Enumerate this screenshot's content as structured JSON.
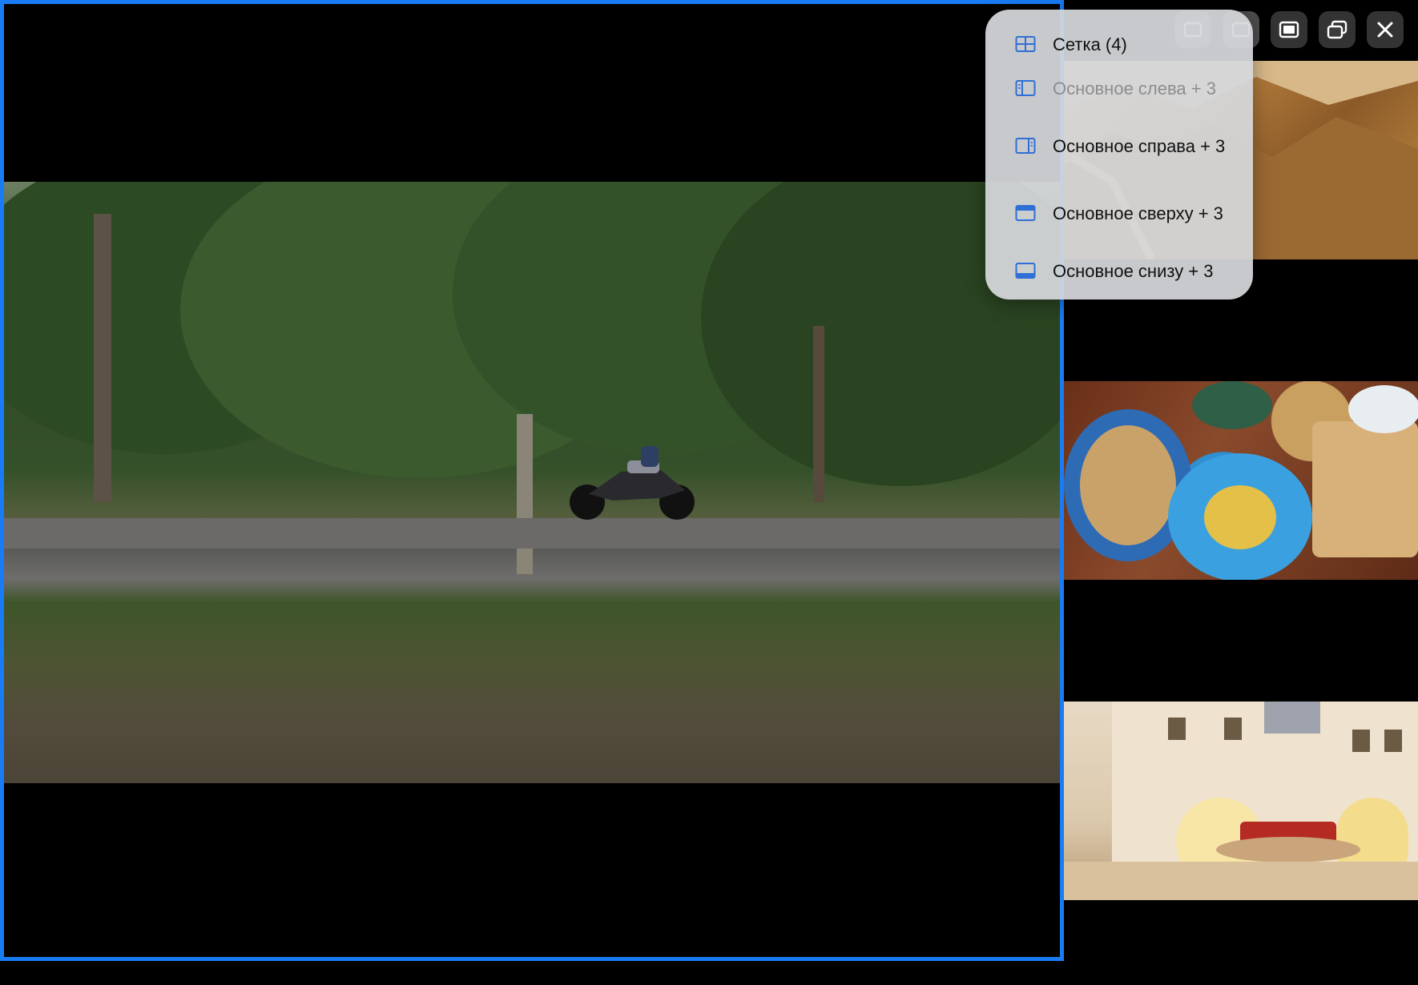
{
  "layout_menu": {
    "items": [
      {
        "label": "Сетка (4)",
        "icon": "grid-layout-icon",
        "disabled": false
      },
      {
        "label": "Основное слева + 3",
        "icon": "main-left-layout-icon",
        "disabled": true
      },
      {
        "label": "Основное справа + 3",
        "icon": "main-right-layout-icon",
        "disabled": false
      },
      {
        "label": "Основное сверху + 3",
        "icon": "main-top-layout-icon",
        "disabled": false
      },
      {
        "label": "Основное снизу + 3",
        "icon": "main-bottom-layout-icon",
        "disabled": false
      }
    ]
  },
  "toolbar": {
    "buttons": [
      "layout-icon",
      "layout-icon",
      "fullscreen-icon",
      "picture-in-picture-icon",
      "close-icon"
    ]
  },
  "colors": {
    "accent": "#1a7cf5",
    "menu_bg": "#d6d8db",
    "icon_blue": "#2f6fd6"
  }
}
